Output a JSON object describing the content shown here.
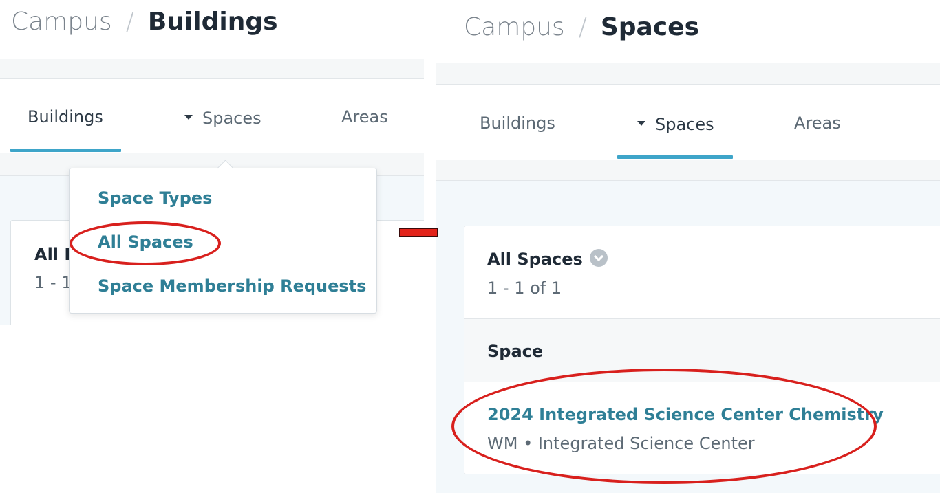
{
  "left_panel": {
    "breadcrumb": {
      "root": "Campus",
      "separator": "/",
      "current": "Buildings"
    },
    "tabs": {
      "buildings": "Buildings",
      "spaces": "Spaces",
      "areas": "Areas"
    },
    "list": {
      "title_partial": "All B",
      "count_partial": "1 - 1"
    },
    "dropdown": {
      "items": [
        "Space Types",
        "All Spaces",
        "Space Membership Requests"
      ]
    }
  },
  "right_panel": {
    "breadcrumb": {
      "root": "Campus",
      "separator": "/",
      "current": "Spaces"
    },
    "tabs": {
      "buildings": "Buildings",
      "spaces": "Spaces",
      "areas": "Areas"
    },
    "list": {
      "title": "All Spaces",
      "count": "1 - 1 of 1",
      "column_header": "Space",
      "rows": [
        {
          "name": "2024 Integrated Science Center Chemistry",
          "subtitle": "WM • Integrated Science Center"
        }
      ]
    }
  },
  "icons": {
    "info": "chevron-down-circle-icon",
    "caret": "caret-down-icon"
  },
  "colors": {
    "accent": "#3ea5c9",
    "link": "#2f7f96",
    "annotation": "#d8201d"
  }
}
